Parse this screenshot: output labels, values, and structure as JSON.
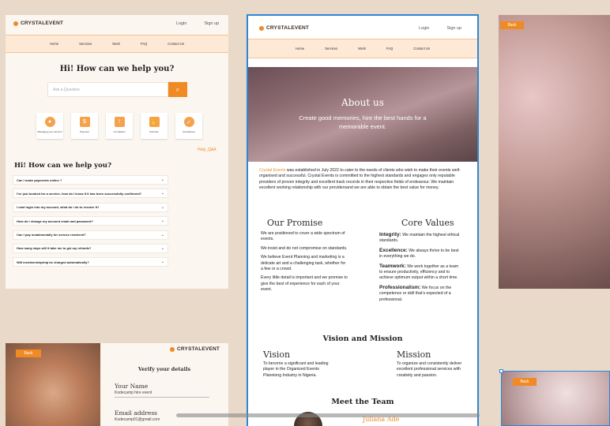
{
  "brand": "CRYSTALEVENT",
  "top_links": {
    "login": "Login",
    "signup": "Sign up"
  },
  "nav": [
    "Home",
    "Services",
    "Work",
    "FAQ",
    "Contact Us"
  ],
  "help_page": {
    "heading": "Hi! How can we help you?",
    "search_placeholder": "Ask a Question",
    "categories": [
      {
        "label": "Managing your account",
        "icon": "user-icon"
      },
      {
        "label": "Payment",
        "icon": "dollar-icon"
      },
      {
        "label": "Complaints",
        "icon": "warning-icon"
      },
      {
        "label": "Refunds",
        "icon": "hand-coin-icon"
      },
      {
        "label": "Guarantees",
        "icon": "badge-icon"
      }
    ],
    "breadcrumb": "Help_Q&A",
    "faq_heading": "Hi! How can we help you?",
    "faqs": [
      "Can I make payments online ?",
      "I've just booked for a service, how do I know if it has been successfully confirmed?",
      "I cant login into my account, what do i do to resolve it?",
      "How do I change my account email and password?",
      "Can I pay instalmentally for service rendered?",
      "How many days will it take me to get my refunds?",
      "Will membershipship be charged automatically?"
    ]
  },
  "about_page": {
    "hero_title": "About us",
    "hero_subtitle": "Create good memories, hire the best hands for a memorable event.",
    "intro_brand": "Crystal Events",
    "intro_text": " was established in July 2022 to cater to the needs of clients who wish to make their events well-organised and successful. Crystal Events is committed to the highest standards and engages only reputable providers of proven integrity and excellent track records in their respective fields of endeavour. We maintain excellent working relationship with our providersand we are able to obtain the best value for money.",
    "promise_title": "Our Promise",
    "promise": [
      "We are positioned to cover a wide spectrum of events.",
      "We insist and do not compromise on standards.",
      "We believe Event Planning and marketing is a delicate art and a challenging task, whether for a few or a crowd.",
      "Every little detail is important and we promise to give the best of experience for each of your event."
    ],
    "values_title": "Core Values",
    "values": [
      {
        "name": "Integrity:",
        "text": " We maintain the highest ethical standards."
      },
      {
        "name": "Excellence:",
        "text": " We always thrive to be best in everything we do."
      },
      {
        "name": "Teamwork:",
        "text": " We work together as a team to ensure productivity, efficiency and to achieve optimum output within a short time."
      },
      {
        "name": "Professionalism:",
        "text": " We focus on the competence or skill that's expected of a professional."
      }
    ],
    "vm_title": "Vision and Mission",
    "vision_title": "Vision",
    "vision_text": "To become a significant and leading player in the Organized Events Planniong Industry in Nigeria.",
    "mission_title": "Mission",
    "mission_text": "To organize and consistently deliver excellent professional services with creativity and passion.",
    "team_title": "Meet the Team",
    "team_member": "Juliana Ade"
  },
  "verify_page": {
    "back": "Back",
    "brand": "CRYSTALEVENT",
    "title": "Verify your details",
    "name_label": "Your Name",
    "name_value": "Kodecamp hire event",
    "email_label": "Email address",
    "email_value": "Kodecamp01@gmail.com"
  },
  "right_back_1": "Back",
  "right_back_2": "Back",
  "colors": {
    "accent": "#f08a24",
    "background": "#e8d9c8",
    "selection": "#2f86d6"
  }
}
